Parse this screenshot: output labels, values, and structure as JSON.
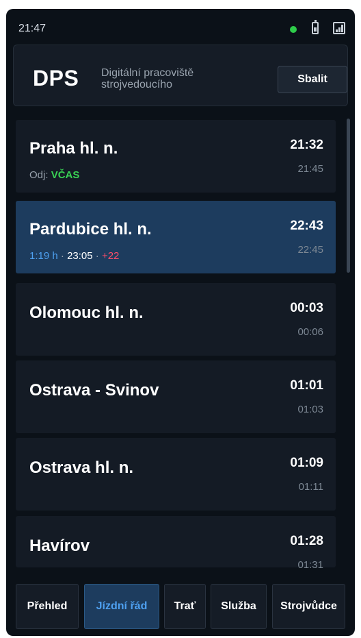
{
  "status": {
    "time": "21:47"
  },
  "header": {
    "logo": "DPS",
    "subtitle_line1": "Digitální pracoviště",
    "subtitle_line2": "strojvedoucího",
    "collapse_label": "Sbalit"
  },
  "stations": [
    {
      "name": "Praha hl. n.",
      "time": "21:32",
      "planned": "21:45",
      "sub_prefix": "Odj: ",
      "sub_status": "VČAS"
    },
    {
      "name": "Pardubice hl. n.",
      "time": "22:43",
      "planned": "22:45",
      "sub_duration": "1:19 h",
      "sub_sep1": " · ",
      "sub_arrival": "23:05",
      "sub_sep2": " · ",
      "sub_delay": "+22"
    },
    {
      "name": "Olomouc hl. n.",
      "time": "00:03",
      "planned": "00:06"
    },
    {
      "name": "Ostrava - Svinov",
      "time": "01:01",
      "planned": "01:03"
    },
    {
      "name": "Ostrava hl. n.",
      "time": "01:09",
      "planned": "01:11"
    },
    {
      "name": "Havírov",
      "time": "01:28",
      "planned": "01:31"
    }
  ],
  "nav": {
    "tabs": [
      "Přehled",
      "Jízdní řád",
      "Trať",
      "Služba",
      "Strojvůdce"
    ],
    "active": "Jízdní řád"
  },
  "colors": {
    "background": "#0b1118",
    "card": "#141b25",
    "active_card": "#1d3c5e",
    "on_time": "#39d154",
    "delay": "#ff4d6a",
    "accent": "#4ea0f0",
    "status_dot": "#2ecc4a"
  },
  "icons": [
    "status-dot-icon",
    "battery-icon",
    "signal-icon"
  ]
}
